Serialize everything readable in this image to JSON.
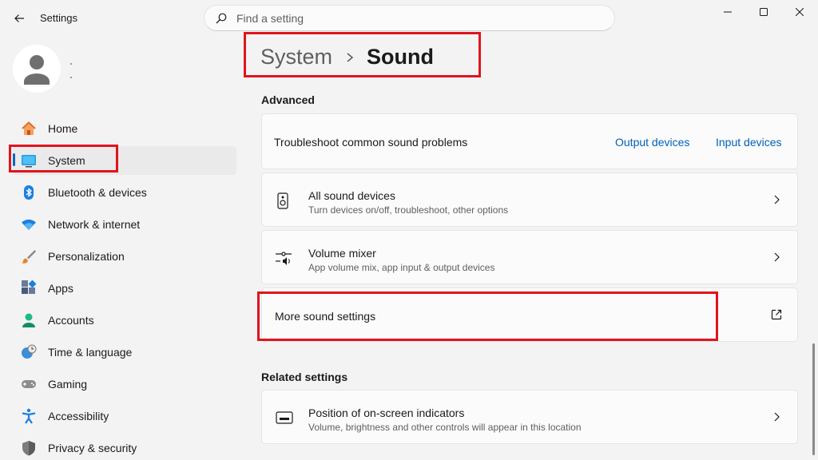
{
  "window": {
    "title": "Settings"
  },
  "search": {
    "placeholder": "Find a setting"
  },
  "sidebar": {
    "items": [
      {
        "label": "Home",
        "icon": "home-icon"
      },
      {
        "label": "System",
        "icon": "system-icon"
      },
      {
        "label": "Bluetooth & devices",
        "icon": "bluetooth-icon"
      },
      {
        "label": "Network & internet",
        "icon": "wifi-icon"
      },
      {
        "label": "Personalization",
        "icon": "brush-icon"
      },
      {
        "label": "Apps",
        "icon": "apps-icon"
      },
      {
        "label": "Accounts",
        "icon": "accounts-icon"
      },
      {
        "label": "Time & language",
        "icon": "time-language-icon"
      },
      {
        "label": "Gaming",
        "icon": "gaming-icon"
      },
      {
        "label": "Accessibility",
        "icon": "accessibility-icon"
      },
      {
        "label": "Privacy & security",
        "icon": "shield-icon"
      }
    ],
    "active_index": 1
  },
  "breadcrumb": {
    "parent": "System",
    "current": "Sound"
  },
  "advanced": {
    "heading": "Advanced",
    "troubleshoot": {
      "label": "Troubleshoot common sound problems",
      "link_output": "Output devices",
      "link_input": "Input devices"
    },
    "all_sound_devices": {
      "title": "All sound devices",
      "subtitle": "Turn devices on/off, troubleshoot, other options"
    },
    "volume_mixer": {
      "title": "Volume mixer",
      "subtitle": "App volume mix, app input & output devices"
    },
    "more_sound_settings": {
      "title": "More sound settings"
    }
  },
  "related": {
    "heading": "Related settings",
    "position_indicators": {
      "title": "Position of on-screen indicators",
      "subtitle": "Volume, brightness and other controls will appear in this location"
    }
  },
  "colors": {
    "accent": "#0067c0",
    "link": "#0061b6",
    "highlight": "#e0141e"
  }
}
